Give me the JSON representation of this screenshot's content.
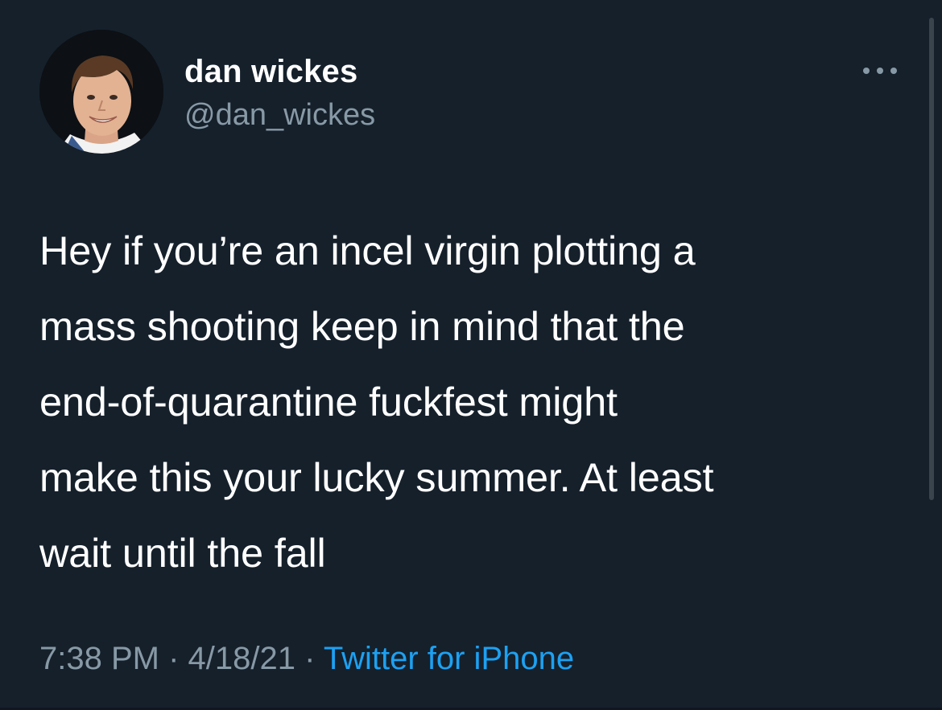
{
  "author": {
    "display_name": "dan wickes",
    "handle": "@dan_wickes",
    "avatar_icon": "profile-photo"
  },
  "tweet": {
    "text": "Hey if you’re an incel virgin plotting a\nmass shooting keep in mind that the\nend-of-quarantine fuckfest might\nmake this your lucky summer. At least\nwait until the fall",
    "time": "7:38 PM",
    "separator": "·",
    "date": "4/18/21",
    "source": "Twitter for iPhone"
  },
  "icons": {
    "more": "more-options-icon"
  },
  "colors": {
    "background": "#15202b",
    "primary_text": "#ffffff",
    "secondary_text": "#8899a6",
    "link": "#1da1f2"
  }
}
